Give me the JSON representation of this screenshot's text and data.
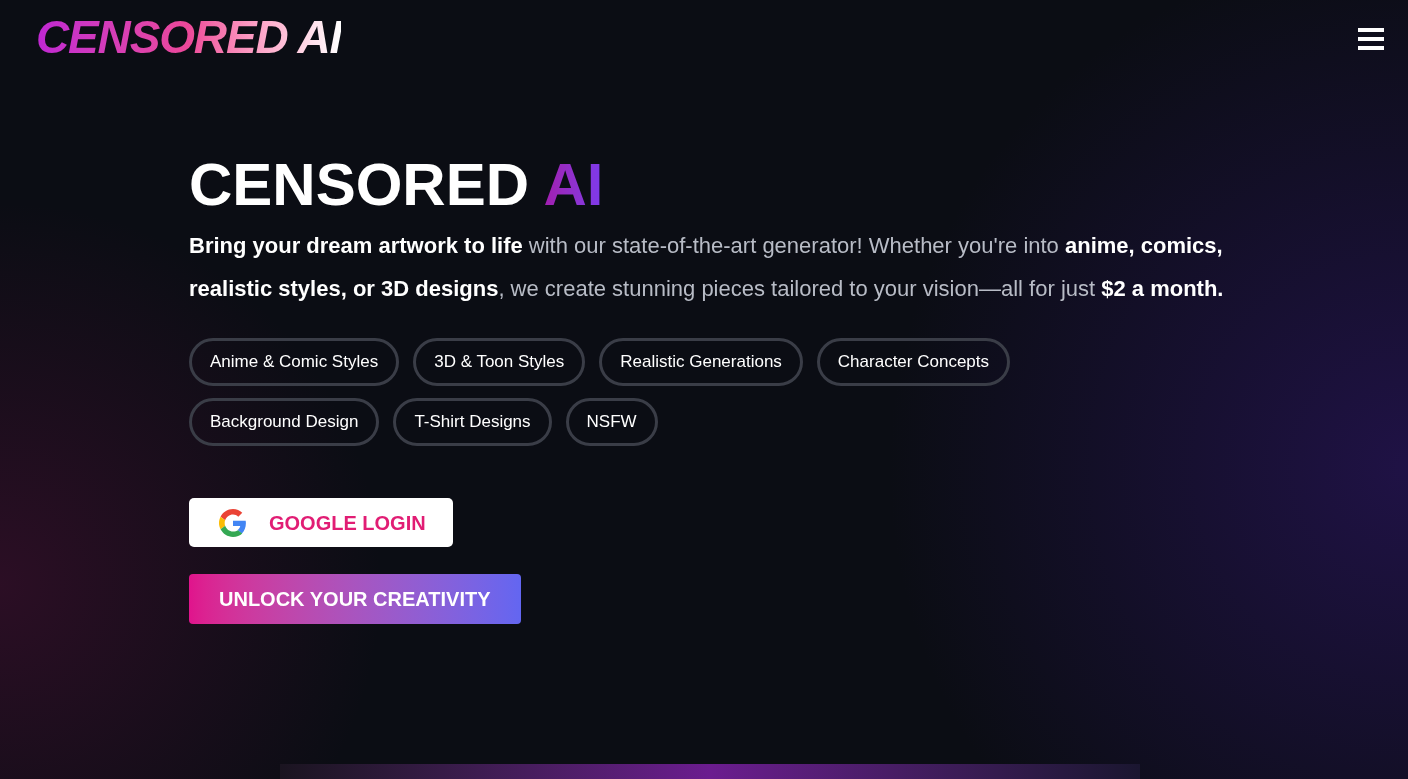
{
  "header": {
    "logo": "CENSORED AI"
  },
  "hero": {
    "title": "CENSORED",
    "title_accent": "AI",
    "description": "**Bring your dream artwork to life** with our state-of-the-art generator! Whether you're into **anime, comics, realistic styles, or 3D designs**, we create stunning pieces tailored to your vision—all for just **$2 a month.**",
    "tags": [
      "Anime & Comic Styles",
      "3D & Toon Styles",
      "Realistic Generations",
      "Character Concepts",
      "Background Design",
      "T-Shirt Designs",
      "NSFW"
    ],
    "google_button": "GOOGLE LOGIN",
    "cta_button": "UNLOCK YOUR CREATIVITY"
  }
}
